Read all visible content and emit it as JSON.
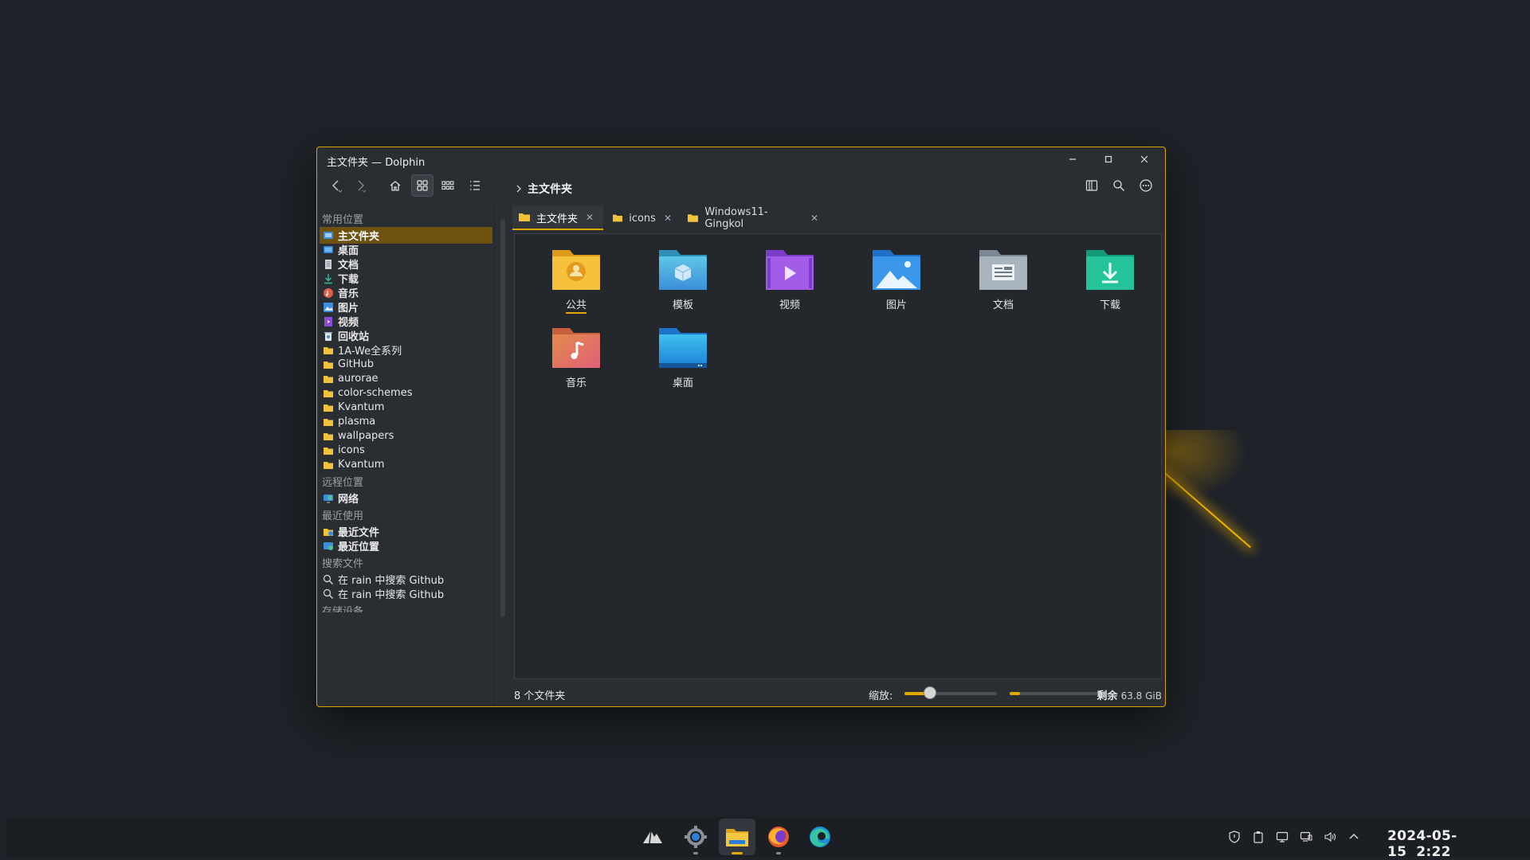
{
  "window": {
    "title": "主文件夹 — Dolphin",
    "accent": "#d9a400"
  },
  "toolbar": {
    "breadcrumb": "主文件夹",
    "view_modes": [
      "icons-view-icon",
      "compact-view-icon",
      "details-view-icon"
    ]
  },
  "sidebar": {
    "sections": {
      "places": "常用位置",
      "remote": "远程位置",
      "recent": "最近使用",
      "search": "搜索文件",
      "devices": "存储设备"
    },
    "places_items": [
      {
        "label": "主文件夹",
        "icon": "home-icon"
      },
      {
        "label": "桌面",
        "icon": "desktop-icon"
      },
      {
        "label": "文档",
        "icon": "document-icon"
      },
      {
        "label": "下载",
        "icon": "download-icon"
      },
      {
        "label": "音乐",
        "icon": "music-icon"
      },
      {
        "label": "图片",
        "icon": "picture-icon"
      },
      {
        "label": "视频",
        "icon": "video-icon"
      },
      {
        "label": "回收站",
        "icon": "trash-icon"
      },
      {
        "label": "1A-We全系列",
        "icon": "folder-icon"
      },
      {
        "label": "GitHub",
        "icon": "folder-icon"
      },
      {
        "label": "aurorae",
        "icon": "folder-icon"
      },
      {
        "label": "color-schemes",
        "icon": "folder-icon"
      },
      {
        "label": "Kvantum",
        "icon": "folder-icon"
      },
      {
        "label": "plasma",
        "icon": "folder-icon"
      },
      {
        "label": "wallpapers",
        "icon": "folder-icon"
      },
      {
        "label": "icons",
        "icon": "folder-icon"
      },
      {
        "label": "Kvantum",
        "icon": "folder-icon"
      }
    ],
    "remote_items": [
      {
        "label": "网络",
        "icon": "network-icon"
      }
    ],
    "recent_items": [
      {
        "label": "最近文件",
        "icon": "recent-files-icon"
      },
      {
        "label": "最近位置",
        "icon": "recent-places-icon"
      }
    ],
    "search_items": [
      {
        "label": "在 rain 中搜索 Github",
        "icon": "search-icon"
      },
      {
        "label": "在 rain 中搜索 Github",
        "icon": "search-icon"
      }
    ]
  },
  "tabs": [
    {
      "label": "主文件夹",
      "active": true
    },
    {
      "label": "icons",
      "active": false
    },
    {
      "label": "Windows11-Gingkol",
      "active": false
    }
  ],
  "files": [
    {
      "label": "公共",
      "icon": "public-folder-icon"
    },
    {
      "label": "模板",
      "icon": "templates-folder-icon"
    },
    {
      "label": "视频",
      "icon": "videos-folder-icon"
    },
    {
      "label": "图片",
      "icon": "pictures-folder-icon"
    },
    {
      "label": "文档",
      "icon": "documents-folder-icon"
    },
    {
      "label": "下载",
      "icon": "downloads-folder-icon"
    },
    {
      "label": "音乐",
      "icon": "music-folder-icon"
    },
    {
      "label": "桌面",
      "icon": "desktop-folder-icon"
    }
  ],
  "status": {
    "count": "8 个文件夹",
    "zoom_label": "缩放:",
    "zoom_level": 0.28,
    "free_prefix": "剩余",
    "free_value": "63.8 GiB",
    "free_fraction": 0.12
  },
  "taskbar": {
    "apps": [
      "launcher-icon",
      "settings-icon",
      "file-manager-icon",
      "firefox-icon",
      "edge-icon"
    ],
    "date": "2024-05-15",
    "time": "2:22"
  }
}
